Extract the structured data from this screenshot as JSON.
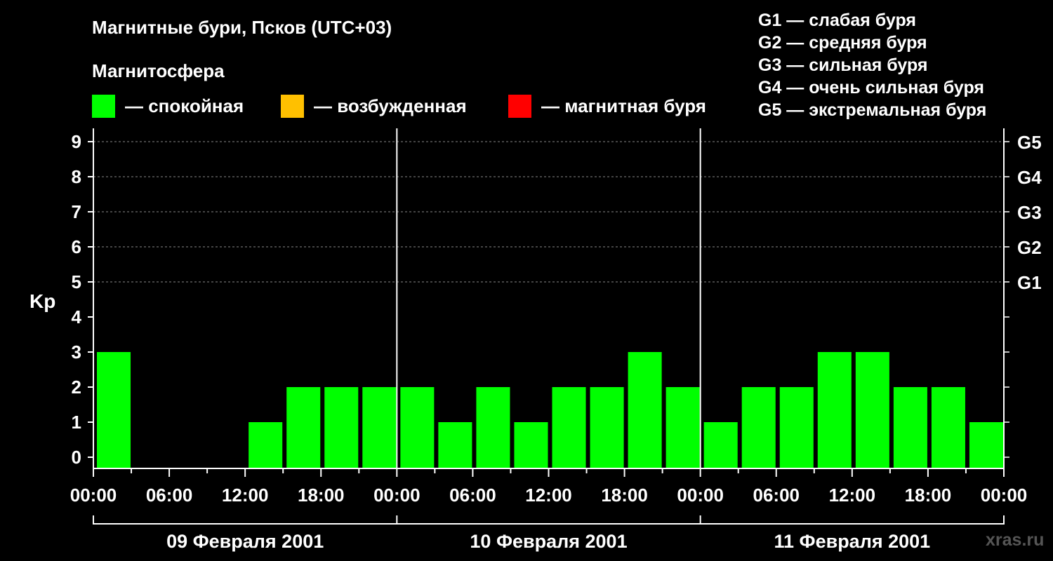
{
  "title": "Магнитные бури, Псков (UTC+03)",
  "legend": {
    "heading": "Магнитосфера",
    "items": [
      {
        "color": "#00ff00",
        "label": "— спокойная"
      },
      {
        "color": "#ffc000",
        "label": "— возбужденная"
      },
      {
        "color": "#ff0000",
        "label": "— магнитная буря"
      }
    ]
  },
  "g_scale": [
    "G1 — слабая буря",
    "G2 — средняя буря",
    "G3 — сильная буря",
    "G4 — очень сильная буря",
    "G5 — экстремальная буря"
  ],
  "watermark": "xras.ru",
  "colors": {
    "background": "#000000",
    "quiet": "#00ff00",
    "grid": "#888888"
  },
  "chart_data": {
    "type": "bar",
    "ylabel": "Kp",
    "ylim": [
      0,
      9
    ],
    "yticks": [
      "0",
      "1",
      "2",
      "3",
      "4",
      "5",
      "6",
      "7",
      "8",
      "9"
    ],
    "right_ticks": [
      {
        "value": 5,
        "label": "G1"
      },
      {
        "value": 6,
        "label": "G2"
      },
      {
        "value": 7,
        "label": "G3"
      },
      {
        "value": 8,
        "label": "G4"
      },
      {
        "value": 9,
        "label": "G5"
      }
    ],
    "grid": "dashed horizontal at Kp 5–9",
    "xtick_labels": [
      "00:00",
      "06:00",
      "12:00",
      "18:00",
      "00:00",
      "06:00",
      "12:00",
      "18:00",
      "00:00",
      "06:00",
      "12:00",
      "18:00",
      "00:00"
    ],
    "days": [
      "09 Февраля 2001",
      "10 Февраля 2001",
      "11 Февраля 2001"
    ],
    "interval_hours": 3,
    "series": [
      {
        "values": [
          3,
          0,
          0,
          0,
          1,
          2,
          2,
          2,
          2,
          1,
          2,
          1,
          2,
          2,
          3,
          2,
          1,
          2,
          2,
          3,
          3,
          2,
          2,
          1
        ]
      }
    ],
    "bar_color": "#00ff00"
  }
}
